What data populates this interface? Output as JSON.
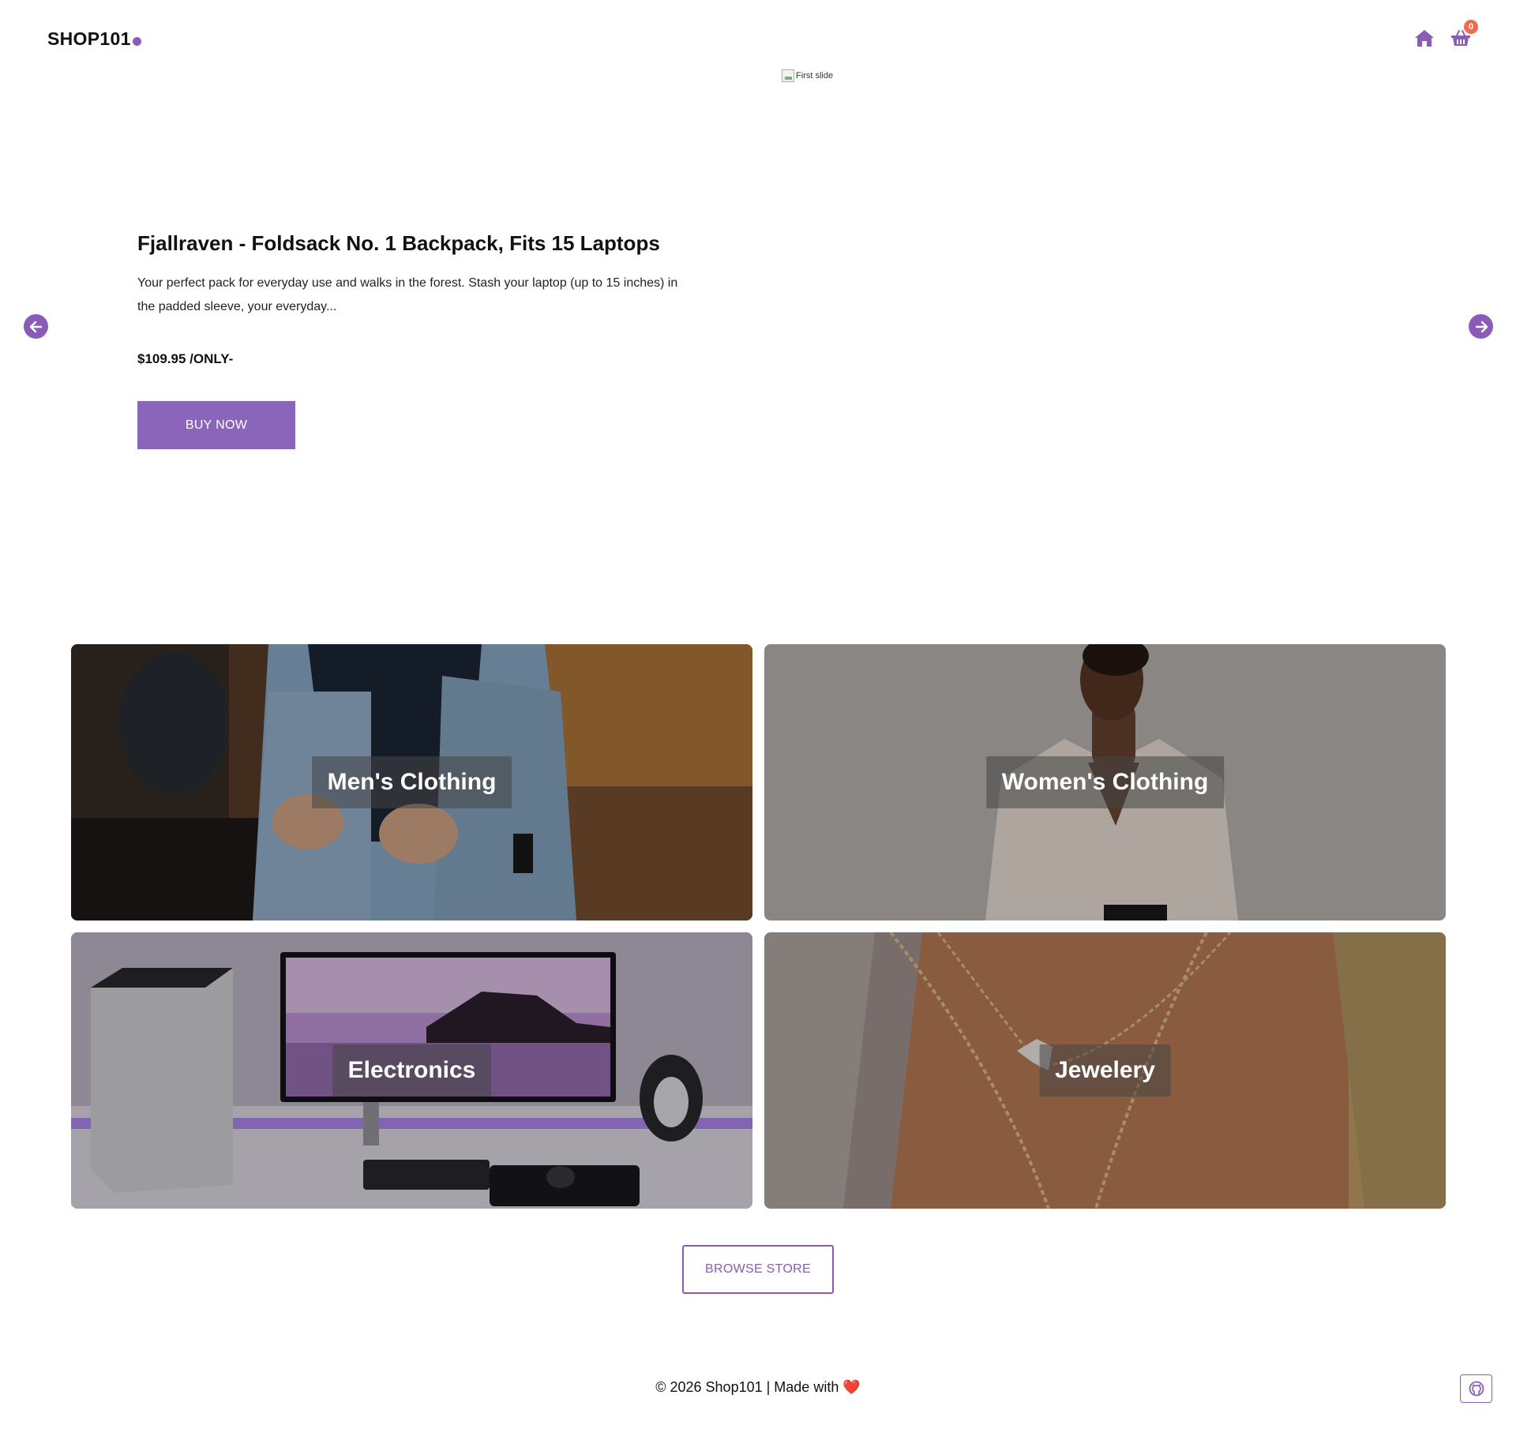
{
  "header": {
    "logo_text": "SHOP101",
    "cart_count": "0",
    "icons": [
      "home-icon",
      "basket-icon"
    ]
  },
  "hero": {
    "image_alt": "First slide",
    "title": "Fjallraven - Foldsack No. 1 Backpack, Fits 15 Laptops",
    "description": "Your perfect pack for everyday use and walks in the forest. Stash your laptop (up to 15 inches) in the padded sleeve, your everyday...",
    "price": "$109.95 /ONLY-",
    "buy_label": "BUY NOW"
  },
  "categories": [
    {
      "label": "Men's Clothing"
    },
    {
      "label": "Women's Clothing"
    },
    {
      "label": "Electronics"
    },
    {
      "label": "Jewelery"
    }
  ],
  "browse_label": "BROWSE STORE",
  "footer": {
    "text": "© 2026 Shop101 | Made with",
    "heart": "❤️"
  },
  "colors": {
    "accent": "#8a5bb8",
    "badge": "#f26b4f"
  }
}
